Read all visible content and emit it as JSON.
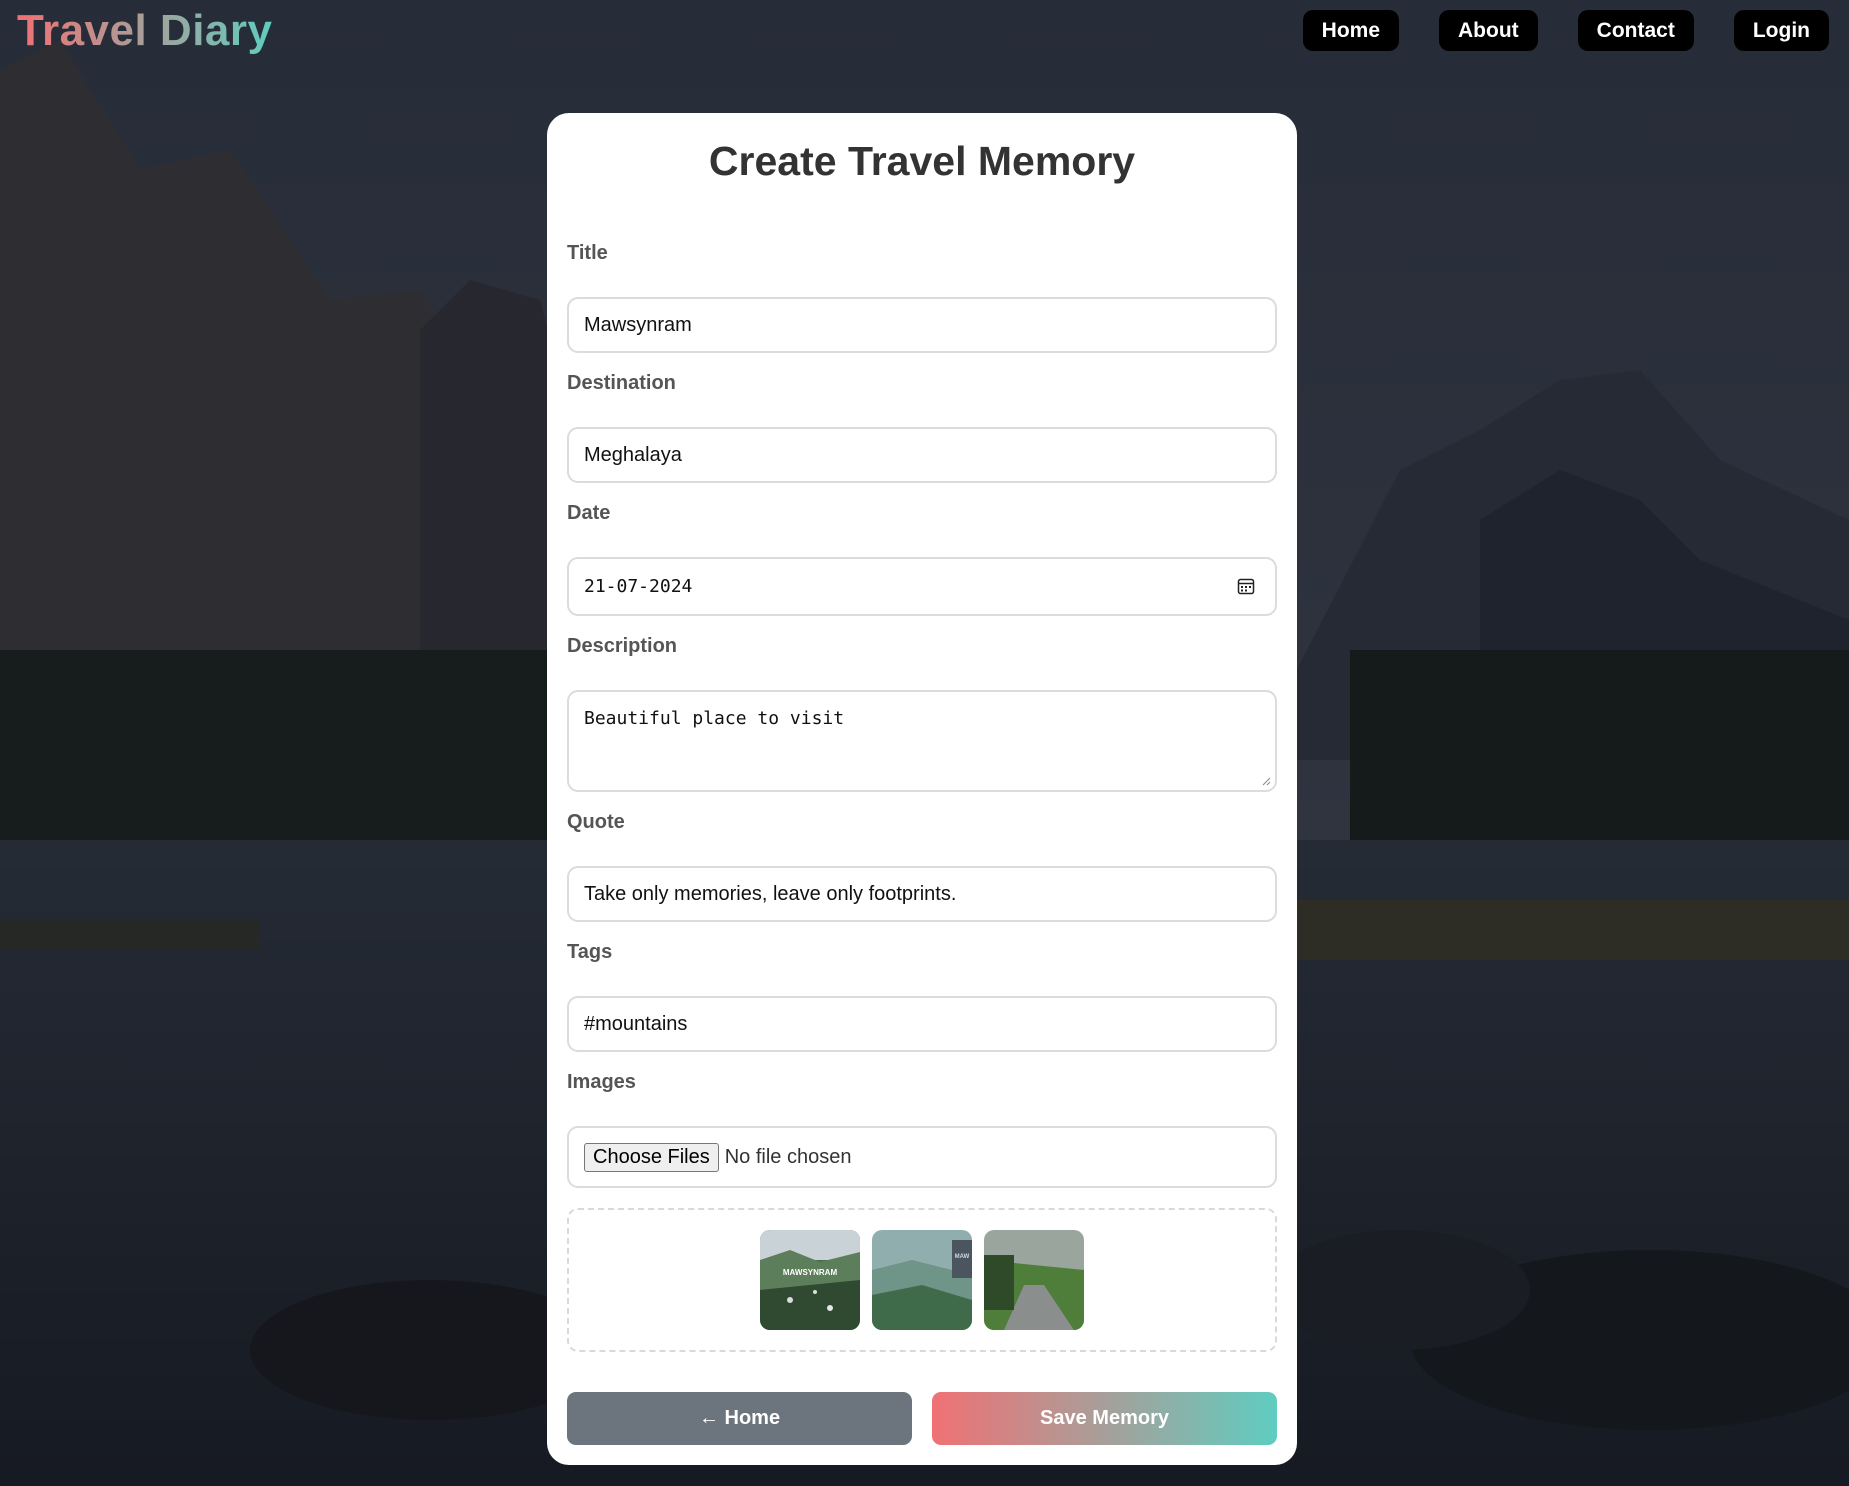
{
  "header": {
    "brand": "Travel Diary",
    "nav": [
      "Home",
      "About",
      "Contact",
      "Login"
    ]
  },
  "form": {
    "title": "Create Travel Memory",
    "fields": {
      "title": {
        "label": "Title",
        "value": "Mawsynram"
      },
      "destination": {
        "label": "Destination",
        "value": "Meghalaya"
      },
      "date": {
        "label": "Date",
        "value": "21-07-2024"
      },
      "description": {
        "label": "Description",
        "value": "Beautiful place to visit"
      },
      "quote": {
        "label": "Quote",
        "value": "Take only memories, leave only footprints."
      },
      "tags": {
        "label": "Tags",
        "value": "#mountains"
      },
      "images": {
        "label": "Images",
        "button": "Choose Files",
        "status": "No file chosen"
      }
    },
    "thumbnails": [
      {
        "caption": "MAWSYNRAM"
      },
      {
        "caption": "MAW"
      },
      {
        "caption": ""
      }
    ],
    "buttons": {
      "home": "← Home",
      "save": "Save Memory"
    }
  },
  "colors": {
    "accent_start": "#f07174",
    "accent_end": "#5fcdc0",
    "home_button": "#6c757d"
  }
}
